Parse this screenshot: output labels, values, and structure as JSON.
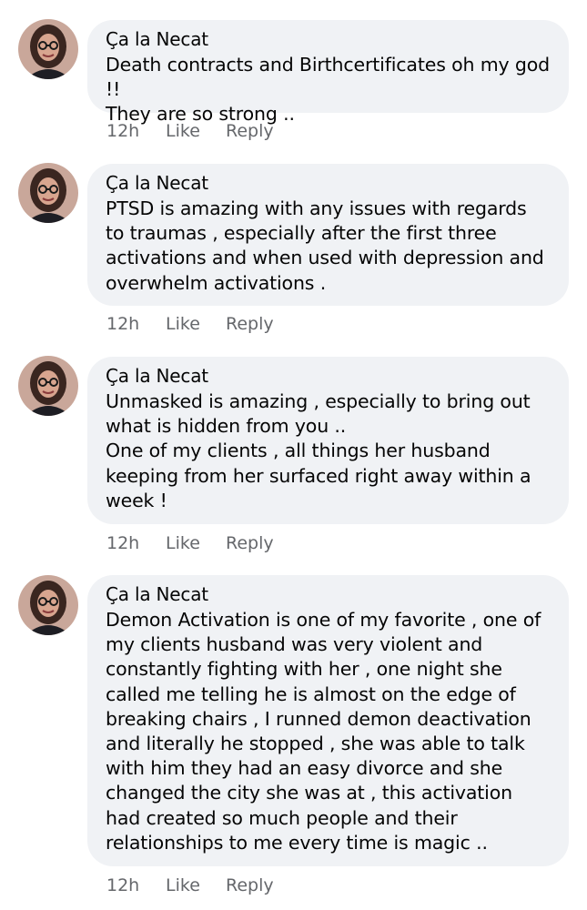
{
  "comments": [
    {
      "author": "Ça la Necat",
      "text": "Death contracts and Birthcertificates oh my god !!\nThey are so strong ..",
      "time": "12h",
      "like_label": "Like",
      "reply_label": "Reply"
    },
    {
      "author": "Ça la Necat",
      "text": "PTSD is amazing with any issues with regards to traumas , especially after the first three activations and when used with depression and overwhelm activations .",
      "time": "12h",
      "like_label": "Like",
      "reply_label": "Reply"
    },
    {
      "author": "Ça la Necat",
      "text": "Unmasked is amazing , especially to bring out what is hidden from you ..\nOne of my clients , all things her husband keeping from her surfaced right away within a week !",
      "time": "12h",
      "like_label": "Like",
      "reply_label": "Reply"
    },
    {
      "author": "Ça la Necat",
      "text": "Demon Activation is one of my favorite , one of my clients husband was very violent and constantly fighting with her , one night she called me telling he is almost on the edge of breaking chairs , I runned demon deactivation and literally he stopped , she was able to talk with him they had an easy divorce and she changed the city she was at , this activation had created so much people and their relationships to me every time is magic ..",
      "time": "12h",
      "like_label": "Like",
      "reply_label": "Reply"
    }
  ]
}
